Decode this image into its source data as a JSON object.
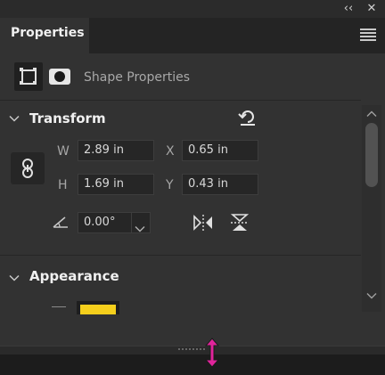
{
  "window": {
    "collapse_glyph": "‹‹",
    "close_glyph": "✕"
  },
  "panel": {
    "tab_label": "Properties",
    "menu_icon": "hamburger-menu-icon"
  },
  "shape_properties": {
    "label": "Shape Properties",
    "icons": [
      "shape-bounds-icon",
      "mask-icon"
    ]
  },
  "transform": {
    "title": "Transform",
    "reset_icon": "reset-transform-icon",
    "link_icon": "chain-link-icon",
    "w_label": "W",
    "w_value": "2.89 in",
    "h_label": "H",
    "h_value": "1.69 in",
    "x_label": "X",
    "x_value": "0.65 in",
    "y_label": "Y",
    "y_value": "0.43 in",
    "angle_icon": "angle-icon",
    "angle_value": "0.00°",
    "flip_icons": [
      "flip-horizontal-icon",
      "flip-vertical-icon"
    ]
  },
  "appearance": {
    "title": "Appearance",
    "fill_color": "#F5CF1C"
  },
  "colors": {
    "accent": "#E0249B"
  }
}
